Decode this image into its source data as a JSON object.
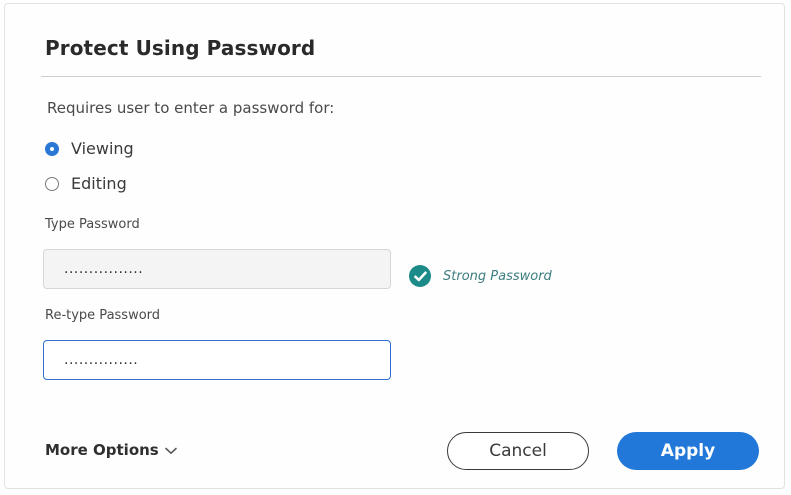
{
  "dialog": {
    "title": "Protect Using Password",
    "requires_text": "Requires user to enter a password for:",
    "options": [
      {
        "label": "Viewing",
        "selected": true
      },
      {
        "label": "Editing",
        "selected": false
      }
    ],
    "type_password": {
      "label": "Type Password",
      "value": "................"
    },
    "strength": {
      "text": "Strong Password",
      "icon": "check-circle-icon",
      "color": "#1b8a88"
    },
    "retype_password": {
      "label": "Re-type Password",
      "value": "..............."
    },
    "more_options_label": "More Options",
    "cancel_label": "Cancel",
    "apply_label": "Apply",
    "accent_color": "#2278d9"
  }
}
